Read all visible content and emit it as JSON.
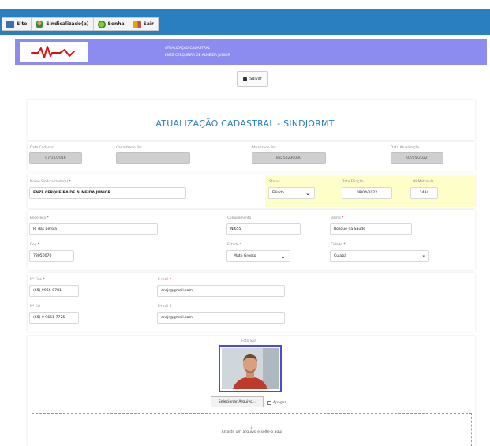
{
  "toolbar": {
    "site": "Site",
    "sindicalizado": "Sindicalizado(a)",
    "senha": "Senha",
    "sair": "Sair"
  },
  "header": {
    "line1": "ATUALIZAÇÃO CADASTRAL",
    "line2": "ENZE CERQUEIRA DE ALMEIDA JUNIOR"
  },
  "save_label": "Salvar",
  "page_title": "ATUALIZAÇÃO CADASTRAL - SINDJORMT",
  "meta": {
    "data_cadastro_label": "Data Cadastro",
    "data_cadastro": "07/11/2016",
    "cadastrado_por_label": "Cadastrado Por",
    "cadastrado_por": "",
    "atualizado_por_label": "Atualizado Por",
    "atualizado_por": "83258230030",
    "data_atualizacao_label": "Data Atualização",
    "data_atualizacao": "02/05/2022"
  },
  "member": {
    "nome_label": "Nome Sindicalizado(a)",
    "nome": "ENZE CERQUEIRA DE ALMEIDA JUNIOR",
    "status_label": "Status",
    "status": "Filiado",
    "data_filiacao_label": "Data Filiação",
    "data_filiacao": "09/04/2022",
    "matricula_label": "Nº Matrícula",
    "matricula": "1484"
  },
  "address": {
    "endereco_label": "Endereço",
    "endereco": "R. das perola",
    "complemento_label": "Complemento",
    "complemento": "NJ655",
    "bairro_label": "Bairro",
    "bairro": "Bosque da Saude",
    "cep_label": "Cep",
    "cep": "78050070",
    "estado_label": "Estado",
    "estado": "Mato Grosso",
    "cidade_label": "Cidade",
    "cidade": "Cuiabá"
  },
  "contact": {
    "fixo_label": "Nº Fixo",
    "fixo": "(65) 9966-8781",
    "email_label": "E-mail",
    "email": "enzjr@gmail.com",
    "cel_label": "Nº Cel",
    "cel": "(65) 9 9651-7725",
    "email2_label": "E-mail 2",
    "email2": "enzjr@gmail.com"
  },
  "photo": {
    "label": "Foto Sua",
    "select_button": "Selecionar Arquivo...",
    "delete_label": "Apagar",
    "dropzone_text": "Arraste um arquivo e solte-o aqui"
  },
  "colors": {
    "topbar": "#2a7fc0",
    "header": "#8c8cf0",
    "title": "#2a7fc0",
    "highlight": "#fefec8"
  }
}
